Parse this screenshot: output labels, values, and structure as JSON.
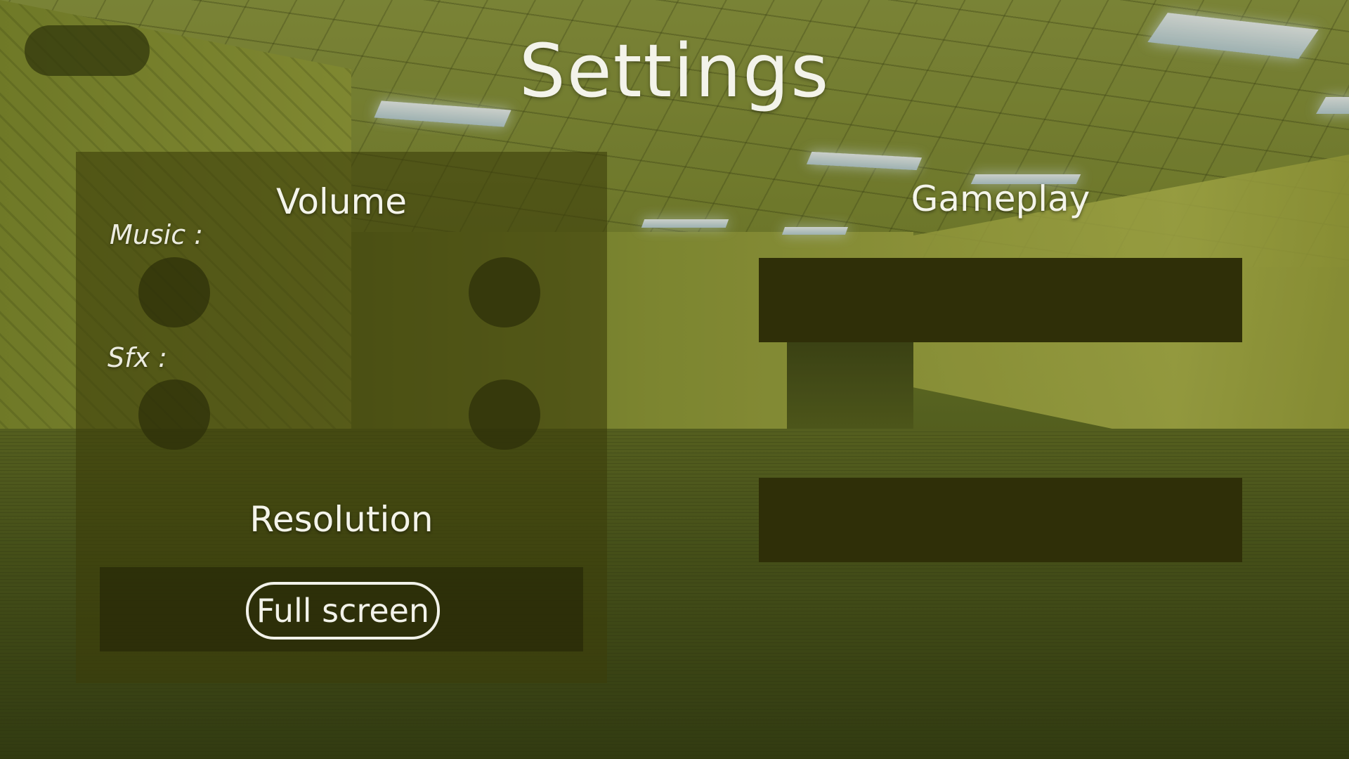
{
  "title": "Settings",
  "volume": {
    "heading": "Volume",
    "music_label": "Music :",
    "sfx_label": "Sfx :"
  },
  "resolution": {
    "heading": "Resolution",
    "fullscreen_label": "Full screen"
  },
  "gameplay": {
    "heading": "Gameplay"
  },
  "colors": {
    "panel": "#3c3e0a",
    "bar": "#2f2f08",
    "text": "#f3f3ea",
    "wall": "#a7ad45"
  }
}
